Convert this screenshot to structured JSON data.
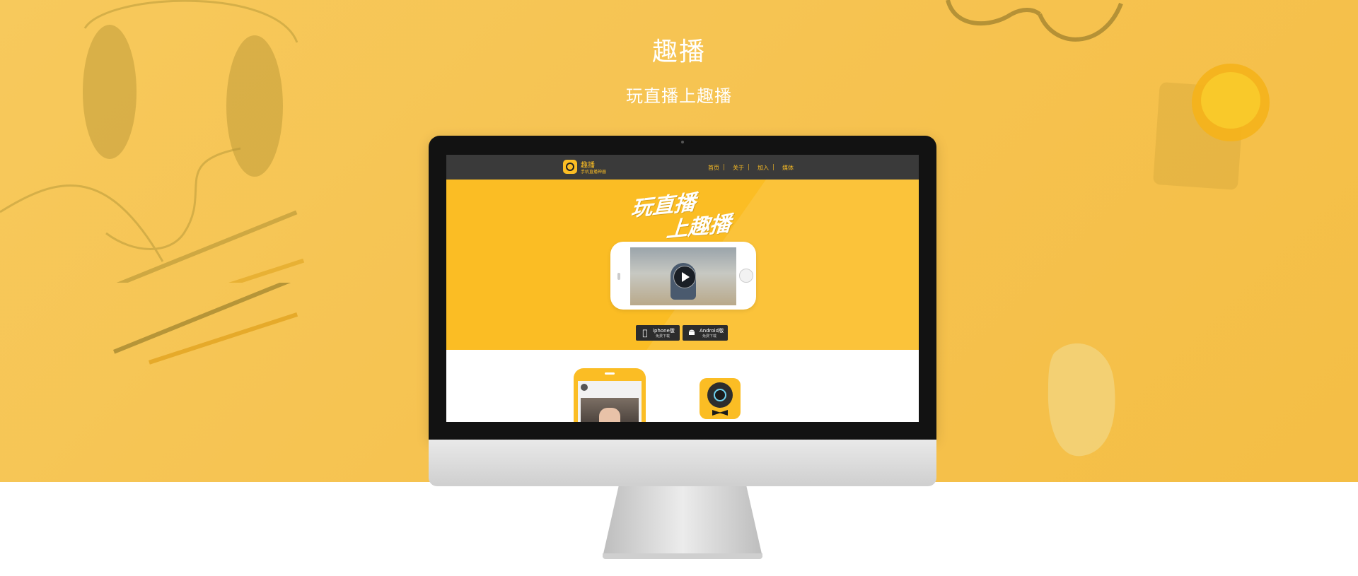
{
  "page": {
    "title": "趣播",
    "subtitle": "玩直播上趣播"
  },
  "site": {
    "logo_name": "趣播",
    "logo_tagline": "手机直播神器",
    "nav": [
      {
        "label": "首页"
      },
      {
        "label": "关于"
      },
      {
        "label": "加入"
      },
      {
        "label": "媒体"
      }
    ],
    "banner": {
      "slogan_line1": "玩直播",
      "slogan_line2": "上趣播"
    },
    "downloads": [
      {
        "platform": "iphone版",
        "note": "免费下载",
        "icon": "apple-icon"
      },
      {
        "platform": "Android版",
        "note": "免费下载",
        "icon": "android-icon"
      }
    ]
  },
  "colors": {
    "hero_background": "#f6c24f",
    "brand_yellow": "#fbbd24",
    "navbar": "#3a3a3a",
    "button_dark": "#2c2c2c"
  }
}
